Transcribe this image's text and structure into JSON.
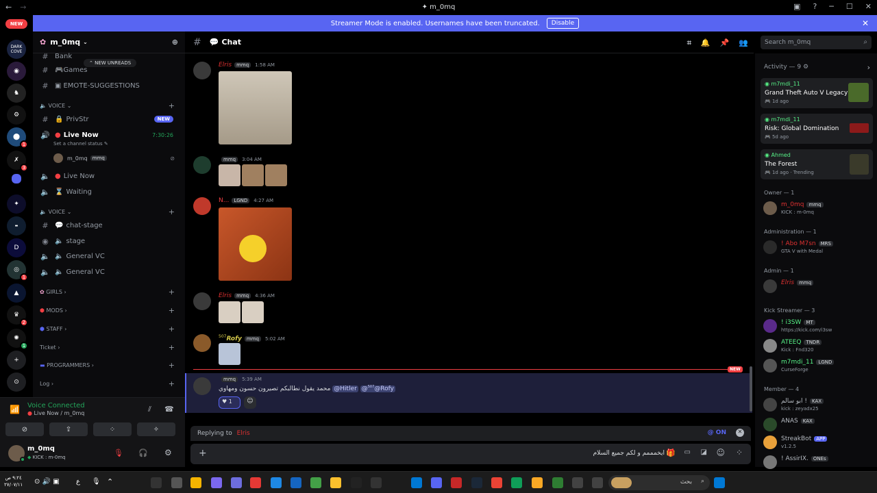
{
  "window": {
    "title": "m_0mq",
    "brand_color": "#5865f2"
  },
  "banner": {
    "text": "Streamer Mode is enabled. Usernames have been truncated.",
    "disable_label": "Disable"
  },
  "guild_rail": {
    "new_label": "NEW",
    "badges": [
      "1",
      "3",
      "1",
      "2",
      "1"
    ],
    "dark_cove": "DARK COVE"
  },
  "server": {
    "name": "m_0mq",
    "new_unreads": "NEW UNREADS",
    "channels_top": [
      "Bank",
      "Games",
      "EMOTE-SUGGESTIONS"
    ],
    "voice_category_1": "VOICE",
    "privstr": "PrivStr",
    "privstr_badge": "NEW",
    "live_now": "Live Now",
    "live_timer": "7:30:26",
    "channel_status_placeholder": "Set a channel status",
    "voice_user": {
      "name": "m_0mq",
      "tag": "mmq"
    },
    "live_now_2": "Live Now",
    "waiting": "Waiting",
    "voice_category_2": "VOICE",
    "chat_stage": "chat-stage",
    "stage": "stage",
    "general_vc_1": "General VC",
    "general_vc_2": "General VC",
    "categories": [
      "GIRLS",
      "MODS",
      "STAFF",
      "Ticket",
      "PROGRAMMERS",
      "Log"
    ]
  },
  "voice_panel": {
    "status": "Voice Connected",
    "location": "Live Now / m_0mq"
  },
  "user_panel": {
    "name": "m_0mq",
    "status": "KICK : m-0mq"
  },
  "chat": {
    "channel_name": "Chat",
    "messages": [
      {
        "author": "Elris",
        "tag": "mmq",
        "time": "1:58 AM",
        "color": "#e03131"
      },
      {
        "author": "",
        "tag": "mmq",
        "time": "3:04 AM",
        "color": "#dbdee1"
      },
      {
        "author": "N...",
        "tag": "LGND",
        "time": "4:27 AM",
        "color": "#f23f43"
      },
      {
        "author": "Elris",
        "tag": "mmq",
        "time": "4:36 AM",
        "color": "#e03131"
      },
      {
        "author": "Rofy",
        "prefix": "507",
        "tag": "mmq",
        "time": "5:02 AM",
        "color": "#d4c84a"
      },
      {
        "author": "",
        "tag": "mmq",
        "time": "5:39 AM",
        "color": "#e03131"
      }
    ],
    "new_label": "NEW",
    "last_text": "محمد يقول نطالبكم تصيرون حسون ومهاوي",
    "mention_1": "@Hitler",
    "mention_2": "@Rofy",
    "mention_2_prefix": "507",
    "reaction_count": "1"
  },
  "composer": {
    "replying_to": "Replying to",
    "replying_name": "Elris",
    "ping": "@ ON",
    "input_text": "ايخمممم و لكم جميع السلام"
  },
  "search": {
    "placeholder": "Search m_0mq"
  },
  "members": {
    "activity_title": "Activity — 9",
    "activities": [
      {
        "user": "m7mdi_11",
        "game": "Grand Theft Auto V Legacy",
        "time": "1d ago"
      },
      {
        "user": "m7mdi_11",
        "game": "Risk: Global Domination",
        "time": "5d ago"
      },
      {
        "user": "Ahmed",
        "game": "The Forest",
        "time": "1d ago",
        "extra": "Trending"
      }
    ],
    "groups": [
      {
        "label": "Owner — 1",
        "members": [
          {
            "name": "m_0mq",
            "tag": "mmq",
            "sub": "KICK : m-0mq",
            "color": "#e03131"
          }
        ]
      },
      {
        "label": "Administration — 1",
        "members": [
          {
            "name": "! Abo M7sn",
            "tag": "MRS",
            "sub": "GTA V with Medal",
            "color": "#e03131"
          }
        ]
      },
      {
        "label": "Admin — 1",
        "members": [
          {
            "name": "Elris",
            "tag": "mmq",
            "sub": "",
            "color": "#e03131"
          }
        ]
      },
      {
        "label": "Kick Streamer — 3",
        "members": [
          {
            "name": "! i3SW",
            "tag": "MT",
            "sub": "https://kick.com/i3sw",
            "color": "#57f287"
          },
          {
            "name": "ATEEQ",
            "tag": "TNDR",
            "sub": "Kick : Fnd320",
            "color": "#57f287"
          },
          {
            "name": "m7mdi_11",
            "tag": "LGND",
            "sub": "CurseForge",
            "color": "#57f287"
          }
        ]
      },
      {
        "label": "Member — 4",
        "members": [
          {
            "name": "ابو سالم !",
            "tag": "KAX",
            "sub": "kick : zeyadx25",
            "color": "#b5bac1"
          },
          {
            "name": "ANAS",
            "tag": "KAX",
            "sub": "",
            "color": "#b5bac1"
          },
          {
            "name": "StreakBot",
            "tag": "APP",
            "sub": "v1.2.5",
            "color": "#b5bac1"
          },
          {
            "name": "! AssirIX.",
            "tag": "ONEs",
            "sub": "",
            "color": "#b5bac1"
          }
        ]
      }
    ]
  },
  "taskbar": {
    "time": "٩:٢٤ ص",
    "date": "٢٧/٠٧/١١",
    "lang": "ع",
    "search": "بحث"
  }
}
